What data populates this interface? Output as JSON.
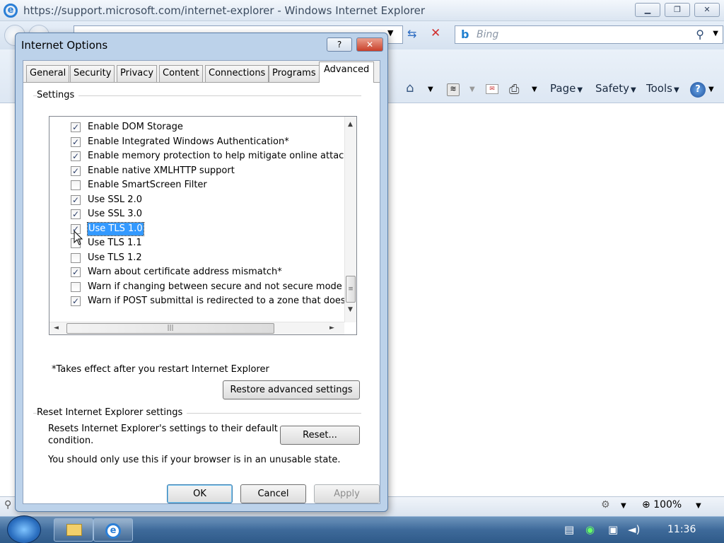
{
  "ie": {
    "window_title": "https://support.microsoft.com/internet-explorer - Windows Internet Explorer",
    "search_placeholder": "Bing",
    "commands": {
      "page": "Page",
      "safety": "Safety",
      "tools": "Tools"
    },
    "zoom": "100%"
  },
  "taskbar": {
    "clock": "11:36"
  },
  "dialog": {
    "title": "Internet Options",
    "help_btn": "?",
    "close_btn": "✕",
    "tabs": [
      "General",
      "Security",
      "Privacy",
      "Content",
      "Connections",
      "Programs",
      "Advanced"
    ],
    "active_tab": "Advanced",
    "settings_label": "Settings",
    "items": [
      {
        "label": "Enable DOM Storage",
        "checked": true
      },
      {
        "label": "Enable Integrated Windows Authentication*",
        "checked": true
      },
      {
        "label": "Enable memory protection to help mitigate online attacks*",
        "checked": true
      },
      {
        "label": "Enable native XMLHTTP support",
        "checked": true
      },
      {
        "label": "Enable SmartScreen Filter",
        "checked": false
      },
      {
        "label": "Use SSL 2.0",
        "checked": true
      },
      {
        "label": "Use SSL 3.0",
        "checked": true
      },
      {
        "label": "Use TLS 1.0",
        "checked": true,
        "selected": true
      },
      {
        "label": "Use TLS 1.1",
        "checked": false
      },
      {
        "label": "Use TLS 1.2",
        "checked": false
      },
      {
        "label": "Warn about certificate address mismatch*",
        "checked": true
      },
      {
        "label": "Warn if changing between secure and not secure mode",
        "checked": false
      },
      {
        "label": "Warn if POST submittal is redirected to a zone that does n",
        "checked": true
      }
    ],
    "restart_note": "*Takes effect after you restart Internet Explorer",
    "restore_button": "Restore advanced settings",
    "reset_group_label": "Reset Internet Explorer settings",
    "reset_desc_line1": "Resets Internet Explorer's settings to their default",
    "reset_desc_line2": "condition.",
    "reset_button": "Reset...",
    "reset_warning": "You should only use this if your browser is in an unusable state.",
    "ok_button": "OK",
    "cancel_button": "Cancel",
    "apply_button": "Apply"
  }
}
